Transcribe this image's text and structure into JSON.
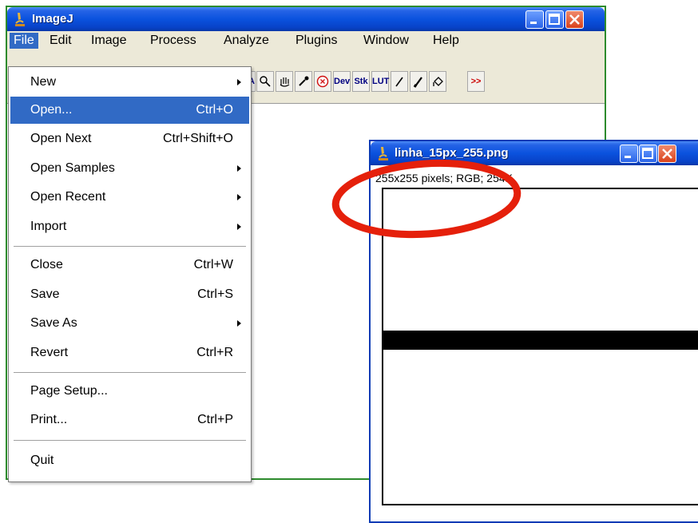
{
  "main_window": {
    "title": "ImageJ",
    "menubar": [
      "File",
      "Edit",
      "Image",
      "Process",
      "Analyze",
      "Plugins",
      "Window",
      "Help"
    ],
    "active_menu": "File",
    "tools": {
      "dev": "Dev",
      "stk": "Stk",
      "lut": "LUT",
      "more": ">>"
    }
  },
  "file_menu": {
    "items": [
      {
        "label": "New",
        "shortcut": "",
        "submenu": true
      },
      {
        "label": "Open...",
        "shortcut": "Ctrl+O",
        "submenu": false,
        "highlighted": true
      },
      {
        "label": "Open Next",
        "shortcut": "Ctrl+Shift+O",
        "submenu": false
      },
      {
        "label": "Open Samples",
        "shortcut": "",
        "submenu": true
      },
      {
        "label": "Open Recent",
        "shortcut": "",
        "submenu": true
      },
      {
        "label": "Import",
        "shortcut": "",
        "submenu": true
      },
      {
        "label": "Close",
        "shortcut": "Ctrl+W",
        "submenu": false
      },
      {
        "label": "Save",
        "shortcut": "Ctrl+S",
        "submenu": false
      },
      {
        "label": "Save As",
        "shortcut": "",
        "submenu": true
      },
      {
        "label": "Revert",
        "shortcut": "Ctrl+R",
        "submenu": false
      },
      {
        "label": "Page Setup...",
        "shortcut": "",
        "submenu": false
      },
      {
        "label": "Print...",
        "shortcut": "Ctrl+P",
        "submenu": false
      },
      {
        "label": "Quit",
        "shortcut": "",
        "submenu": false
      }
    ]
  },
  "image_window": {
    "title": "linha_15px_255.png",
    "info": "255x255 pixels; RGB; 254K"
  },
  "colors": {
    "titlebar_blue": "#0a52de",
    "menu_highlight": "#316ac5",
    "annotation_red": "#e5200b",
    "main_window_border": "#2d8b2d"
  }
}
